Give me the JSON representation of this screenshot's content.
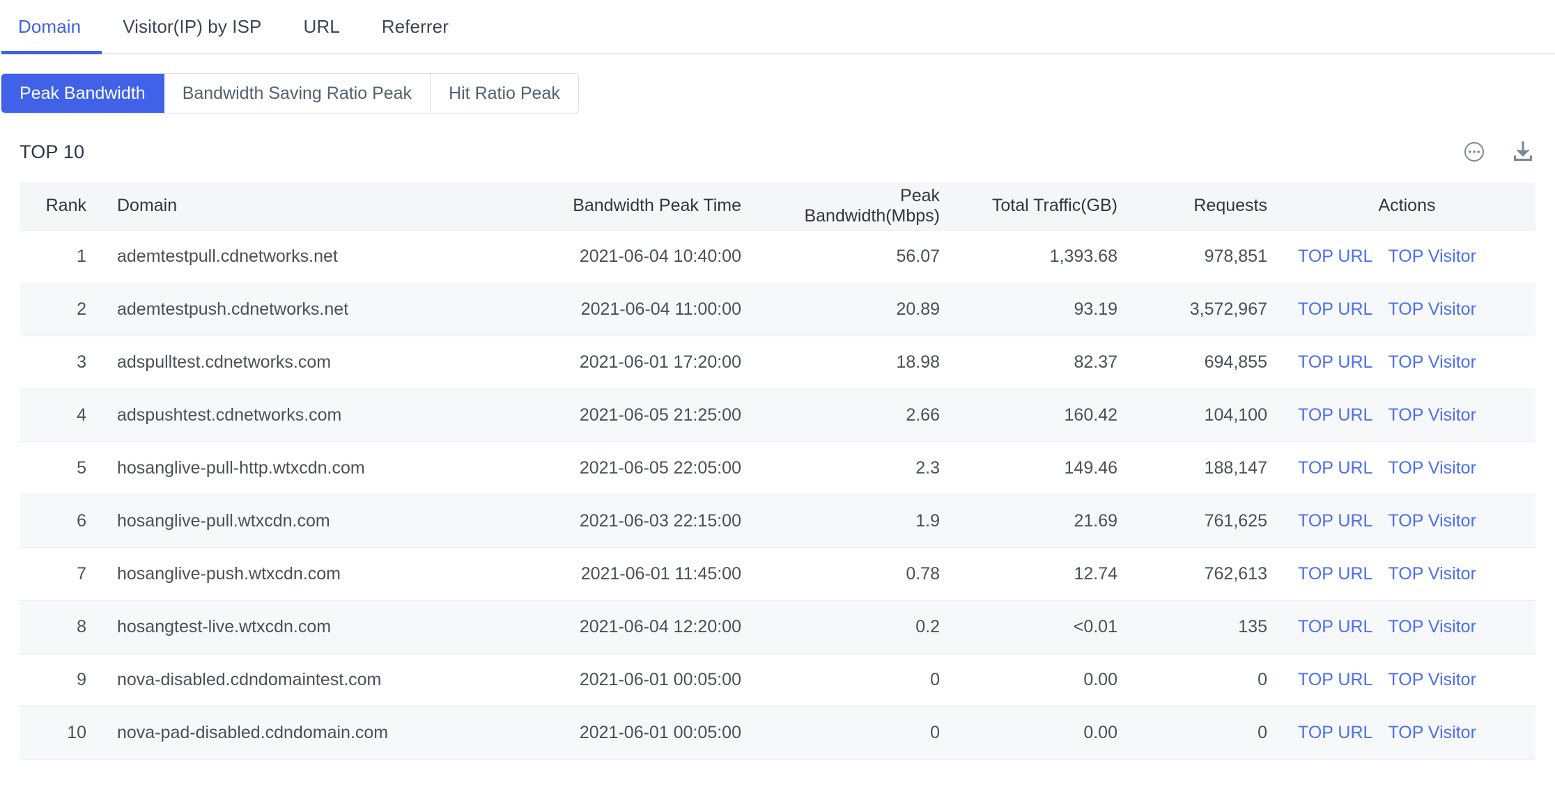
{
  "tabs": [
    {
      "label": "Domain",
      "active": true
    },
    {
      "label": "Visitor(IP) by ISP",
      "active": false
    },
    {
      "label": "URL",
      "active": false
    },
    {
      "label": "Referrer",
      "active": false
    }
  ],
  "segmented": [
    {
      "label": "Peak Bandwidth",
      "active": true
    },
    {
      "label": "Bandwidth Saving Ratio Peak",
      "active": false
    },
    {
      "label": "Hit Ratio Peak",
      "active": false
    }
  ],
  "section": {
    "title": "TOP 10",
    "more_icon": "ellipsis-circle-icon",
    "download_icon": "download-icon"
  },
  "colors": {
    "accent": "#3f62e8",
    "link": "#4b6ef5",
    "header_bg": "#f5f6f7",
    "row_alt_bg": "#f7f8f9"
  },
  "table": {
    "columns": [
      "Rank",
      "Domain",
      "Bandwidth Peak Time",
      "Peak Bandwidth(Mbps)",
      "Total Traffic(GB)",
      "Requests",
      "Actions"
    ],
    "action_labels": {
      "top_url": "TOP URL",
      "top_visitor": "TOP Visitor"
    },
    "rows": [
      {
        "rank": "1",
        "domain": "ademtestpull.cdnetworks.net",
        "peak_time": "2021-06-04 10:40:00",
        "peak_bandwidth": "56.07",
        "total_traffic": "1,393.68",
        "requests": "978,851"
      },
      {
        "rank": "2",
        "domain": "ademtestpush.cdnetworks.net",
        "peak_time": "2021-06-04 11:00:00",
        "peak_bandwidth": "20.89",
        "total_traffic": "93.19",
        "requests": "3,572,967"
      },
      {
        "rank": "3",
        "domain": "adspulltest.cdnetworks.com",
        "peak_time": "2021-06-01 17:20:00",
        "peak_bandwidth": "18.98",
        "total_traffic": "82.37",
        "requests": "694,855"
      },
      {
        "rank": "4",
        "domain": "adspushtest.cdnetworks.com",
        "peak_time": "2021-06-05 21:25:00",
        "peak_bandwidth": "2.66",
        "total_traffic": "160.42",
        "requests": "104,100"
      },
      {
        "rank": "5",
        "domain": "hosanglive-pull-http.wtxcdn.com",
        "peak_time": "2021-06-05 22:05:00",
        "peak_bandwidth": "2.3",
        "total_traffic": "149.46",
        "requests": "188,147"
      },
      {
        "rank": "6",
        "domain": "hosanglive-pull.wtxcdn.com",
        "peak_time": "2021-06-03 22:15:00",
        "peak_bandwidth": "1.9",
        "total_traffic": "21.69",
        "requests": "761,625"
      },
      {
        "rank": "7",
        "domain": "hosanglive-push.wtxcdn.com",
        "peak_time": "2021-06-01 11:45:00",
        "peak_bandwidth": "0.78",
        "total_traffic": "12.74",
        "requests": "762,613"
      },
      {
        "rank": "8",
        "domain": "hosangtest-live.wtxcdn.com",
        "peak_time": "2021-06-04 12:20:00",
        "peak_bandwidth": "0.2",
        "total_traffic": "<0.01",
        "requests": "135"
      },
      {
        "rank": "9",
        "domain": "nova-disabled.cdndomaintest.com",
        "peak_time": "2021-06-01 00:05:00",
        "peak_bandwidth": "0",
        "total_traffic": "0.00",
        "requests": "0"
      },
      {
        "rank": "10",
        "domain": "nova-pad-disabled.cdndomain.com",
        "peak_time": "2021-06-01 00:05:00",
        "peak_bandwidth": "0",
        "total_traffic": "0.00",
        "requests": "0"
      }
    ]
  }
}
